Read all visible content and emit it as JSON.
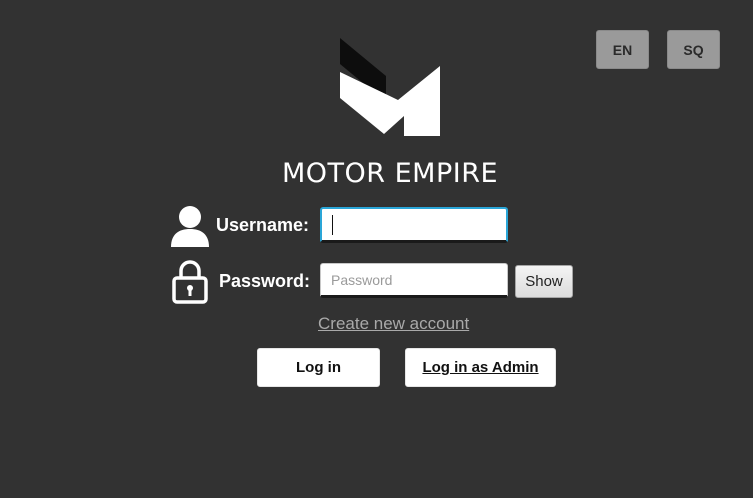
{
  "language": {
    "en_label": "EN",
    "sq_label": "SQ"
  },
  "brand": {
    "name": "MOTOR EMPIRE",
    "logo_icon": "motor-empire-m-logo"
  },
  "form": {
    "username_label": "Username:",
    "username_value": "",
    "password_label": "Password:",
    "password_value": "",
    "password_placeholder": "Password",
    "show_label": "Show",
    "create_account_label": "Create new account"
  },
  "actions": {
    "login_label": "Log in",
    "admin_login_label": "Log in as Admin"
  },
  "icons": {
    "user": "user-icon",
    "lock": "lock-icon"
  },
  "colors": {
    "background": "#323232",
    "focus_border": "#2aa6d8",
    "lang_button": "#9a9a9a",
    "link": "#a9a9a9"
  }
}
